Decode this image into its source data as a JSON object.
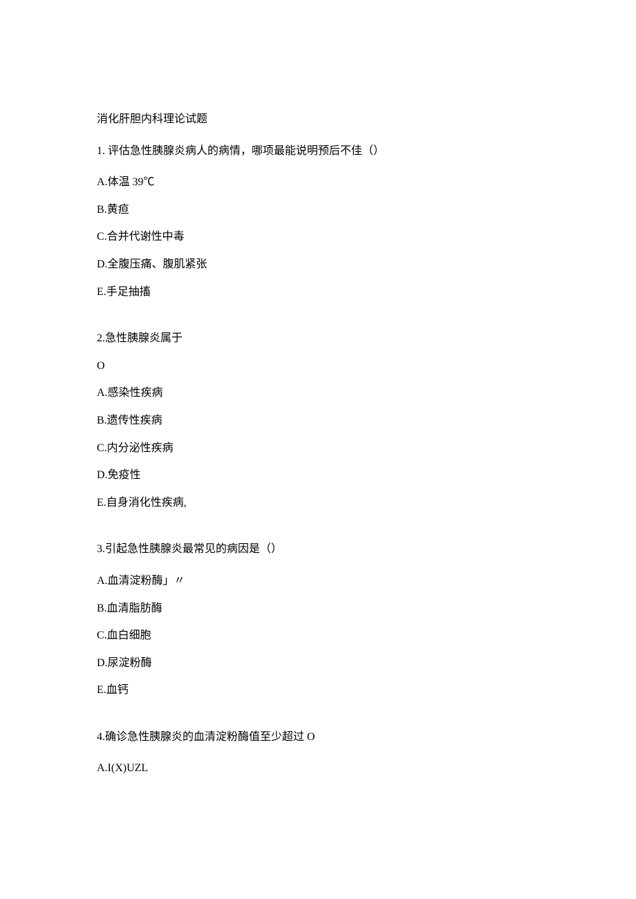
{
  "title": "消化肝胆内科理论试题",
  "questions": [
    {
      "stem": "1. 评估急性胰腺炎病人的病情，哪项最能说明预后不佳（）",
      "options": [
        "A.体温 39℃",
        "B.黄疸",
        "C.合并代谢性中毒",
        "D.全腹压痛、腹肌紧张",
        "E.手足抽搐"
      ]
    },
    {
      "stem": "2.急性胰腺炎属于",
      "stemLine2": "O",
      "options": [
        "A.感染性疾病",
        "B.遗传性疾病",
        "C.内分泌性疾病",
        "D.免疫性",
        "E.自身消化性疾病,"
      ]
    },
    {
      "stem": "3.引起急性胰腺炎最常见的病因是（）",
      "options": [
        "A.血清淀粉酶」〃",
        "B.血清脂肪酶",
        "C.血白细胞",
        "D.尿淀粉酶",
        "E.血钙"
      ]
    },
    {
      "stem": "4.确诊急性胰腺炎的血清淀粉酶值至少超过 O",
      "options": [
        "A.I(X)UZL"
      ]
    }
  ]
}
